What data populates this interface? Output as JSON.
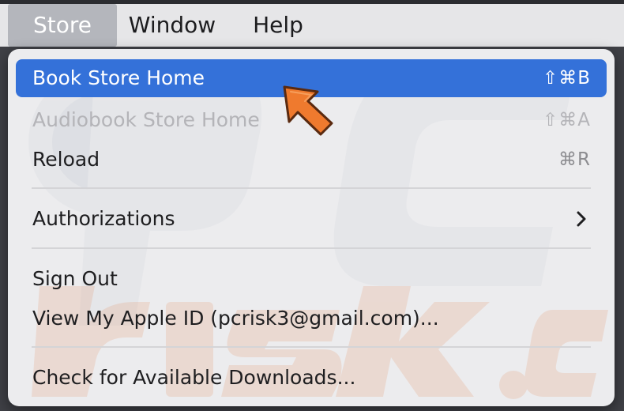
{
  "menubar": {
    "items": [
      {
        "label": "Store",
        "active": true
      },
      {
        "label": "Window",
        "active": false
      },
      {
        "label": "Help",
        "active": false
      }
    ]
  },
  "menu": {
    "items": [
      {
        "label": "Book Store Home",
        "shortcut": "⇧⌘B",
        "state": "highlighted"
      },
      {
        "label": "Audiobook Store Home",
        "shortcut": "⇧⌘A",
        "state": "disabled"
      },
      {
        "label": "Reload",
        "shortcut": "⌘R",
        "state": "normal"
      },
      {
        "label": "Authorizations",
        "submenu_icon": "chevron-right-icon",
        "state": "normal"
      },
      {
        "label": "Sign Out",
        "state": "normal"
      },
      {
        "label": "View My Apple ID (pcrisk3@gmail.com)...",
        "state": "normal"
      },
      {
        "label": "Check for Available Downloads...",
        "state": "normal"
      }
    ]
  },
  "overlay": {
    "pointer_icon": "orange-arrow-pointer-icon",
    "watermark_icon": "pcrisk-watermark-icon"
  },
  "colors": {
    "highlight": "#3471d9",
    "menu_background": "#ececee",
    "menubar_background": "#e6e6e8",
    "arrow_fill": "#ef7a2e",
    "disabled_text": "#b4b4b8"
  }
}
